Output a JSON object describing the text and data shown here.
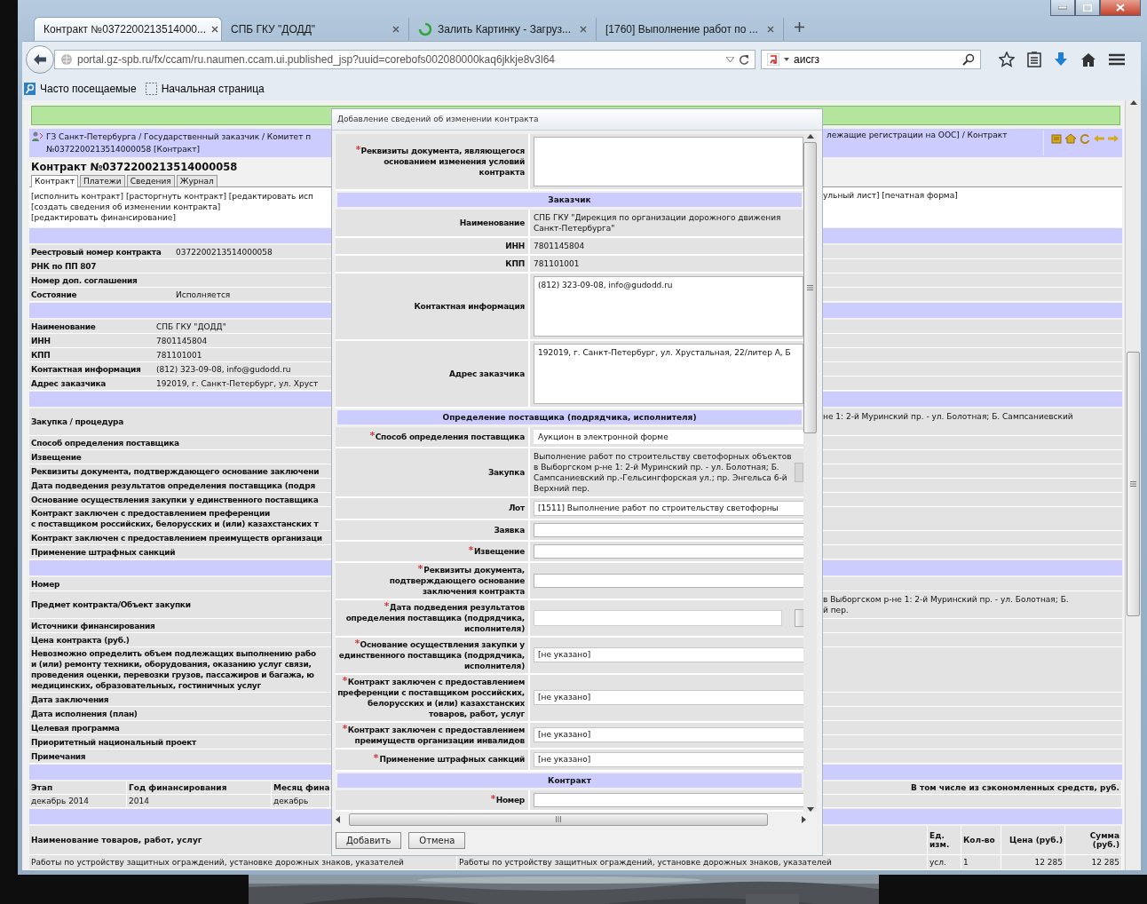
{
  "browser": {
    "tabs": [
      {
        "title": "Контракт №0372200213514000...",
        "selected": true,
        "loading": false
      },
      {
        "title": "СПБ ГКУ \"ДОДД\"",
        "selected": false,
        "loading": false
      },
      {
        "title": "Залить Картинку - Загруз...",
        "selected": false,
        "loading": true
      },
      {
        "title": "[1760] Выполнение работ по ...",
        "selected": false,
        "loading": false
      }
    ],
    "url": "portal.gz-spb.ru/fx/ccam/ru.naumen.ccam.ui.published_jsp?uuid=corebofs002080000kaq6jkkje8v3l64",
    "search": "аисгз",
    "bookmarks": [
      "Часто посещаемые",
      "Начальная страница"
    ]
  },
  "page": {
    "breadcrumb": {
      "left": [
        "ГЗ Санкт-Петербурга / Государственный заказчик / Комитет п",
        "№0372200213514000058 [Контракт]"
      ],
      "right": "лежащие регистрации на ООС] / Контракт"
    },
    "title": "Контракт №0372200213514000058",
    "tabs": [
      {
        "label": "Контракт",
        "selected": true
      },
      {
        "label": "Платежи",
        "selected": false
      },
      {
        "label": "Сведения",
        "selected": false
      },
      {
        "label": "Журнал",
        "selected": false
      }
    ],
    "actions": {
      "left": [
        "[исполнить контракт] [расторгнуть контракт] [редактировать исп",
        "[создать сведения об изменении контракта]",
        "[редактировать финансирование]"
      ],
      "right": "ульный лист] [печатная форма]"
    },
    "sections": [
      {
        "kind": "registry",
        "rows": [
          {
            "label": "Реестровый номер контракта",
            "value": "0372200213514000058"
          },
          {
            "label": "РНК по ПП 807"
          },
          {
            "label": "Номер доп. соглашения"
          },
          {
            "label": "Состояние",
            "value": "Исполняется"
          }
        ]
      },
      {
        "kind": "customer",
        "rows": [
          {
            "label": "Наименование",
            "value": "СПБ ГКУ \"ДОДД\""
          },
          {
            "label": "ИНН",
            "value": "7801145804"
          },
          {
            "label": "КПП",
            "value": "781101001"
          },
          {
            "label": "Контактная информация",
            "value": "(812) 323-09-08, info@gudodd.ru"
          },
          {
            "label": "Адрес заказчика",
            "value": "192019, г. Санкт-Петербург, ул. Хруст"
          }
        ]
      },
      {
        "kind": "list",
        "rows": [
          {
            "label": "Закупка / процедура",
            "right": "не 1: 2-й Муринский пр. - ул. Болотная; Б. Сампсаниевский"
          },
          {
            "label": "Способ определения поставщика"
          },
          {
            "label": "Извещение"
          },
          {
            "label": "Реквизиты документа, подтверждающего основание заключени"
          },
          {
            "label": "Дата подведения результатов определения поставщика (подря"
          },
          {
            "label": "Основание осуществления закупки у единственного поставщика"
          },
          {
            "label": "Контракт заключен с предоставлением преференции\nс поставщиком российских, белорусских и (или) казахстанских т"
          },
          {
            "label": "Контракт заключен с предоставлением преимуществ организаци"
          },
          {
            "label": "Применение штрафных санкций"
          }
        ]
      },
      {
        "kind": "list",
        "rows": [
          {
            "label": "Номер"
          },
          {
            "label": "Предмет контракта/Объект закупки",
            "right": "в Выборгском р-не 1: 2-й Муринский пр. - ул. Болотная; Б.\nй пер."
          },
          {
            "label": "Источники финансирования"
          },
          {
            "label": "Цена контракта (руб.)"
          },
          {
            "label": "Невозможно определить объем подлежащих выполнению рабо\nи (или) ремонту техники, оборудования, оказанию услуг связи, \nпроведения оценки, перевозки грузов, пассажиров и багажа, ю\nмедицинских, образовательных, гостиничных услуг"
          },
          {
            "label": "Дата заключения"
          },
          {
            "label": "Дата исполнения (план)"
          },
          {
            "label": "Целевая программа"
          },
          {
            "label": "Приоритетный национальный проект"
          },
          {
            "label": "Примечания"
          }
        ]
      }
    ],
    "finance_table": {
      "columns": [
        "Этап",
        "Год финансирования",
        "Месяц фина"
      ],
      "right_column": "В том числе из сэкономленных средств, руб.",
      "rows": [
        [
          "декабрь 2014",
          "2014",
          "декабрь"
        ]
      ]
    },
    "goods_table": {
      "columns": [
        "Наименование товаров, работ, услуг",
        "Ед. изм.",
        "Кол-во",
        "Цена (руб.)",
        "Сумма (руб.)"
      ],
      "rows": [
        {
          "name": "Работы по устройству защитных ограждений, установке дорожных знаков, указателей",
          "column_2": "Работы по устройству защитных ограждений, установке дорожных знаков, указателей",
          "unit": "усл.",
          "quantity": "1",
          "price": "12 285",
          "sum": "12 285"
        }
      ]
    }
  },
  "dialog": {
    "title": "Добавление сведений об изменении контракта",
    "rows": [
      {
        "kind": "textarea",
        "label": "Реквизиты документа, являющегося основанием изменения условий контракта",
        "required": true
      },
      {
        "kind": "section",
        "label": "Заказчик"
      },
      {
        "kind": "text",
        "label": "Наименование",
        "value": "СПБ ГКУ \"Дирекция по организации дорожного движения Санкт-Петербурга\"",
        "required": false
      },
      {
        "kind": "text",
        "label": "ИНН",
        "value": "7801145804",
        "required": false
      },
      {
        "kind": "text",
        "label": "КПП",
        "value": "781101001",
        "required": false
      },
      {
        "kind": "textarea",
        "label": "Контактная информация",
        "value": "(812) 323-09-08, info@gudodd.ru",
        "required": false
      },
      {
        "kind": "textarea",
        "label": "Адрес заказчика",
        "value": "192019, г. Санкт-Петербург, ул. Хрустальная, 22/литер А, Б",
        "required": false
      },
      {
        "kind": "section",
        "label": "Определение поставщика (подрядчика, исполнителя)"
      },
      {
        "kind": "readonly",
        "label": "Способ определения поставщика",
        "value": "Аукцион в электронной форме",
        "required": true
      },
      {
        "kind": "text",
        "label": "Закупка",
        "value": "Выполнение работ по строительству светофорных объектов в Выборгском р-не 1: 2-й Муринский пр. - ул. Болотная; Б. Сампсаниевский пр.-Гельсингфорская ул.; пр. Энгельса 6-й Верхний пер.",
        "required": false
      },
      {
        "kind": "select",
        "label": "Лот",
        "value": "[1511] Выполнение работ по строительству светофорны",
        "required": false
      },
      {
        "kind": "input",
        "label": "Заявка",
        "required": false
      },
      {
        "kind": "input",
        "label": "Извещение",
        "required": true
      },
      {
        "kind": "input",
        "label": "Реквизиты документа, подтверждающего основание заключения контракта",
        "required": true
      },
      {
        "kind": "date",
        "label": "Дата подведения результатов определения поставщика (подрядчика, исполнителя)",
        "required": true
      },
      {
        "kind": "select",
        "label": "Основание осуществления закупки у единственного поставщика (подрядчика, исполнителя)",
        "value": "[не указано]",
        "required": true
      },
      {
        "kind": "select",
        "label": "Контракт заключен с предоставлением преференции с поставщиком российских, белорусских и (или) казахстанских товаров, работ, услуг",
        "value": "[не указано]",
        "required": true
      },
      {
        "kind": "select",
        "label": "Контракт заключен с предоставлением преимуществ организации инвалидов",
        "value": "[не указано]",
        "required": true
      },
      {
        "kind": "select",
        "label": "Применение штрафных санкций",
        "value": "[не указано]",
        "required": true
      },
      {
        "kind": "section",
        "label": "Контракт"
      },
      {
        "kind": "input",
        "label": "Номер",
        "required": true
      }
    ],
    "buttons": [
      "Добавить",
      "Отмена"
    ]
  }
}
